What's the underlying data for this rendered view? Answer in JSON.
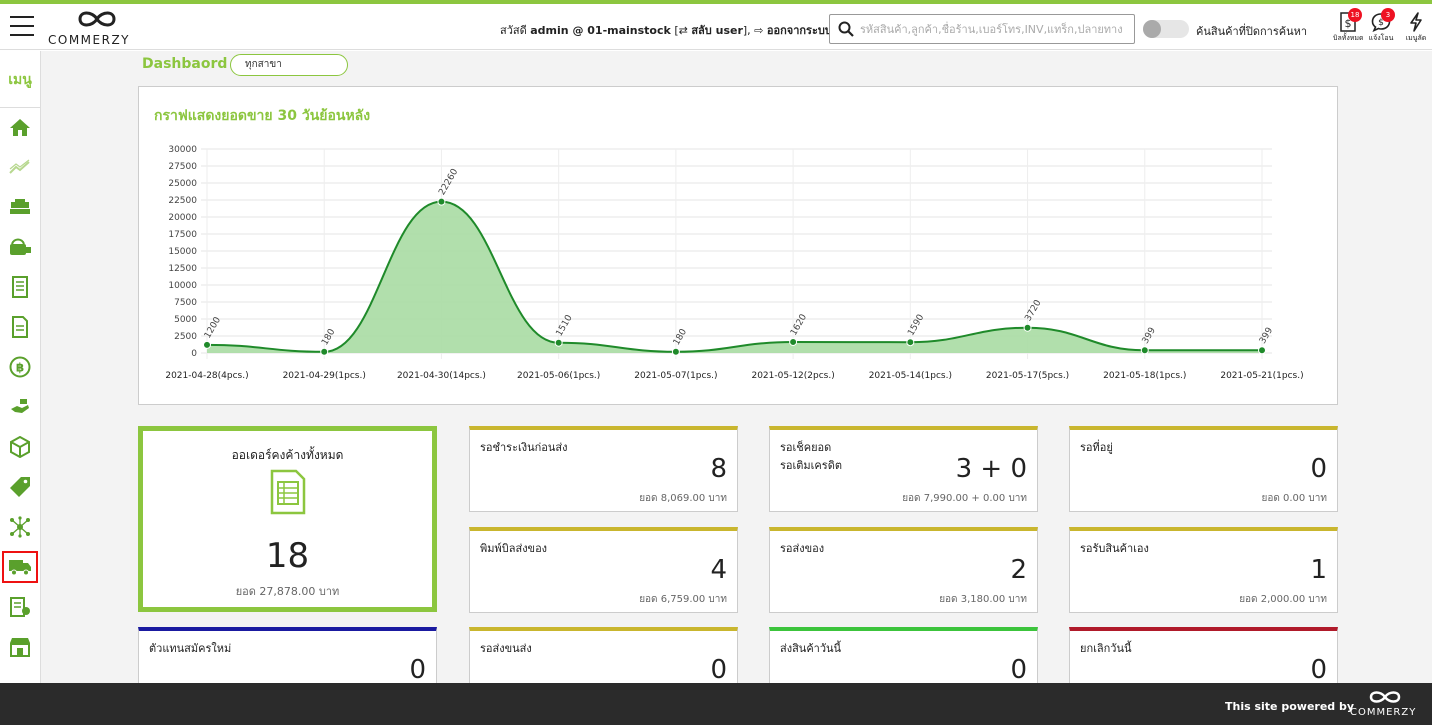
{
  "header": {
    "brand": "COMMERZY",
    "greeting_prefix": "สวัสดี",
    "user": "admin @ 01-mainstock",
    "switch_user": "สลับ user",
    "logout": "ออกจากระบบ",
    "search_placeholder": "รหัสสินค้า,ลูกค้า,ชื่อร้าน,เบอร์โทร,INV,แทร็ก,ปลายทาง",
    "toggle_label": "ค้นสินค้าที่ปิดการค้นหา",
    "icons": [
      {
        "name": "all-bills-icon",
        "label": "บิลทั้งหมด",
        "badge": "18"
      },
      {
        "name": "notifications-icon",
        "label": "แจ้งโอน",
        "badge": "3"
      },
      {
        "name": "quick-menu-icon",
        "label": "เมนูลัด",
        "badge": ""
      }
    ]
  },
  "sidebar": {
    "title": "เมนู",
    "items": [
      "home-icon",
      "trend-icon",
      "cash-register-icon",
      "delivery-box-icon",
      "document-icon",
      "document-edit-icon",
      "coin-icon",
      "hand-cash-icon",
      "package-icon",
      "price-tag-icon",
      "network-icon",
      "truck-icon",
      "receipt-icon",
      "store-icon"
    ],
    "active_index": 11
  },
  "dashboard": {
    "title": "Dashbaord :",
    "branch": "ทุกสาขา"
  },
  "chart_data": {
    "type": "area",
    "title": "กราฟแสดงยอดขาย 30 วันย้อนหลัง",
    "categories": [
      "2021-04-28(4pcs.)",
      "2021-04-29(1pcs.)",
      "2021-04-30(14pcs.)",
      "2021-05-06(1pcs.)",
      "2021-05-07(1pcs.)",
      "2021-05-12(2pcs.)",
      "2021-05-14(1pcs.)",
      "2021-05-17(5pcs.)",
      "2021-05-18(1pcs.)",
      "2021-05-21(1pcs.)"
    ],
    "values": [
      1200,
      180,
      22260,
      1510,
      180,
      1620,
      1590,
      3720,
      399,
      399
    ],
    "yticks": [
      0,
      2500,
      5000,
      7500,
      10000,
      12500,
      15000,
      17500,
      20000,
      22500,
      25000,
      27500,
      30000
    ],
    "ylim": [
      0,
      30000
    ],
    "line_color": "#1f8a2a",
    "fill_color": "#a9dba3",
    "grid": true
  },
  "cards": {
    "big": {
      "title": "ออเดอร์คงค้างทั้งหมด",
      "value": "18",
      "sub": "ยอด 27,878.00 บาท"
    },
    "items": [
      {
        "title": "รอชำระเงินก่อนส่ง",
        "title2": "",
        "value": "8",
        "sub": "ยอด 8,069.00 บาท",
        "color": "#c9b62e"
      },
      {
        "title": "รอเช็คยอด",
        "title2": "รอเติมเครดิต",
        "value": "3 + 0",
        "sub": "ยอด 7,990.00 + 0.00 บาท",
        "color": "#c9b62e"
      },
      {
        "title": "รอที่อยู่",
        "title2": "",
        "value": "0",
        "sub": "ยอด 0.00 บาท",
        "color": "#c9b62e"
      },
      {
        "title": "พิมพ์บิลส่งของ",
        "title2": "",
        "value": "4",
        "sub": "ยอด 6,759.00 บาท",
        "color": "#c9b62e"
      },
      {
        "title": "รอส่งของ",
        "title2": "",
        "value": "2",
        "sub": "ยอด 3,180.00 บาท",
        "color": "#c9b62e"
      },
      {
        "title": "รอรับสินค้าเอง",
        "title2": "",
        "value": "1",
        "sub": "ยอด 2,000.00 บาท",
        "color": "#c9b62e"
      },
      {
        "title": "ตัวแทนสมัครใหม่",
        "title2": "",
        "value": "0",
        "sub": "",
        "color": "#1a1aa0"
      },
      {
        "title": "รอส่งขนส่ง",
        "title2": "",
        "value": "0",
        "sub": "",
        "color": "#c9b62e"
      },
      {
        "title": "ส่งสินค้าวันนี้",
        "title2": "",
        "value": "0",
        "sub": "",
        "color": "#3cc43c"
      },
      {
        "title": "ยกเลิกวันนี้",
        "title2": "",
        "value": "0",
        "sub": "",
        "color": "#b01a2a"
      }
    ]
  },
  "footer": {
    "powered": "This site powered by",
    "brand": "COMMERZY"
  }
}
